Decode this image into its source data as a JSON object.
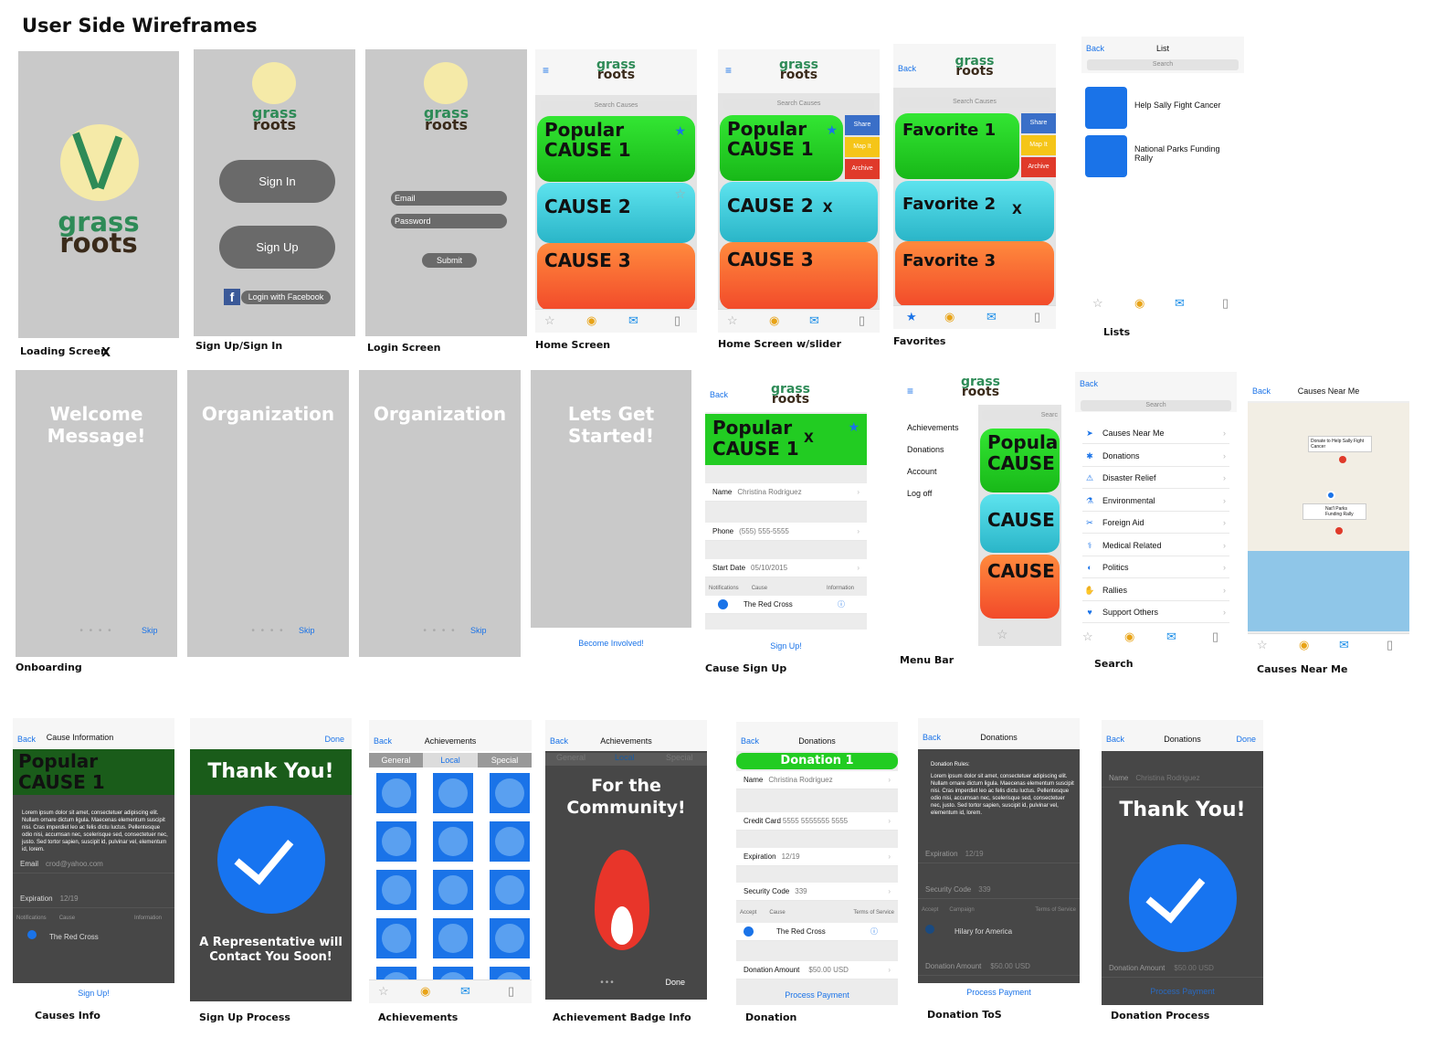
{
  "page_title": "User Side Wireframes",
  "brand": {
    "grass": "grass",
    "roots": "roots"
  },
  "common": {
    "back": "Back",
    "done": "Done",
    "search": "Search",
    "search_causes": "Search Causes",
    "x": "X"
  },
  "captions": {
    "loading": "Loading Screen",
    "signup_signin": "Sign Up/Sign In",
    "login": "Login Screen",
    "home": "Home Screen",
    "home_slider": "Home Screen w/slider",
    "favorites": "Favorites",
    "lists": "Lists",
    "onboarding": "Onboarding",
    "cause_signup": "Cause Sign Up",
    "menu_bar": "Menu Bar",
    "search": "Search",
    "causes_near": "Causes Near Me",
    "causes_info": "Causes Info",
    "signup_process": "Sign Up Process",
    "achievements": "Achievements",
    "badge_info": "Achievement Badge Info",
    "donation": "Donation",
    "donation_tos": "Donation ToS",
    "donation_process": "Donation Process"
  },
  "signin": {
    "sign_in": "Sign In",
    "sign_up": "Sign Up",
    "facebook": "Login with Facebook"
  },
  "login": {
    "email": "Email",
    "password": "Password",
    "submit": "Submit"
  },
  "home_cards": {
    "popular": "Popular",
    "cause1": "CAUSE 1",
    "cause2": "CAUSE 2",
    "cause3": "CAUSE 3"
  },
  "slider": {
    "share": "Share",
    "map": "Map It",
    "archive": "Archive"
  },
  "favorites": {
    "f1": "Favorite 1",
    "f2": "Favorite 2",
    "f3": "Favorite 3"
  },
  "lists": {
    "title": "List",
    "item1": "Help Sally Fight Cancer",
    "item2": "National Parks Funding Rally"
  },
  "onboarding": {
    "welcome": "Welcome Message!",
    "org": "Organization",
    "start": "Lets Get Started!",
    "skip": "Skip",
    "become": "Become Involved!"
  },
  "cause_form": {
    "name_label": "Name",
    "name_value": "Christina Rodriguez",
    "phone_label": "Phone",
    "phone_value": "(555) 555-5555",
    "start_label": "Start Date",
    "start_value": "05/10/2015",
    "notif": "Notifications",
    "cause": "Cause",
    "info": "Information",
    "red_cross": "The Red Cross",
    "signup": "Sign Up!"
  },
  "menu": {
    "achievements": "Achievements",
    "donations": "Donations",
    "account": "Account",
    "logoff": "Log off",
    "search_short": "Searc",
    "popula": "Popula",
    "cause_caps": "CAUSE"
  },
  "categories": [
    "Causes Near Me",
    "Donations",
    "Disaster Relief",
    "Environmental",
    "Foreign Aid",
    "Medical Related",
    "Politics",
    "Rallies",
    "Support Others"
  ],
  "map": {
    "title": "Causes Near Me",
    "pin1": "Donate to Help Sally Fight Cancer",
    "pin2": "Nat'l Parks Funding Rally"
  },
  "cause_info": {
    "title": "Cause Information",
    "email_label": "Email",
    "email_value": "crod@yahoo.com",
    "expiration_label": "Expiration",
    "expiration_value": "12/19",
    "lorem": "Lorem ipsum dolor sit amet, consectetuer adipiscing elit. Nullam ornare dictum ligula. Maecenas elementum suscipit nisi. Cras imperdiet leo ac felis dictu luctus. Pellentesque odio nisi, accumsan nec, scelerisque sed, consectetuer nec, justo. Sed tortor sapien, suscipit id, pulvinar vel, elementum id, lorem."
  },
  "thanks": {
    "thank_you": "Thank You!",
    "rep": "A Representative will Contact You Soon!"
  },
  "achievements": {
    "title": "Achievements",
    "tab_general": "General",
    "tab_local": "Local",
    "tab_special": "Special",
    "community": "For the Community!"
  },
  "donation": {
    "title": "Donations",
    "donation1": "Donation 1",
    "cc_label": "Credit Card",
    "cc_value": "5555 5555555 5555",
    "sec_label": "Security Code",
    "sec_value": "339",
    "accept": "Accept",
    "tos": "Terms of Service",
    "campaign": "Campaign",
    "amount_label": "Donation Amount",
    "amount_value": "$50.00 USD",
    "process": "Process Payment",
    "rules": "Donation Rules:",
    "hilary": "Hilary for America"
  }
}
